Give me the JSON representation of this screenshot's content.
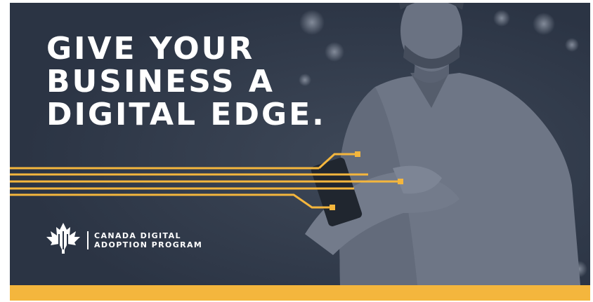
{
  "headline": {
    "lines": [
      "GIVE YOUR",
      "BUSINESS A",
      "DIGITAL EDGE."
    ]
  },
  "logo": {
    "icon": "maple-leaf-icon",
    "lines": [
      "CANADA DIGITAL",
      "ADOPTION PROGRAM"
    ]
  },
  "colors": {
    "background": "#2b3444",
    "accent": "#f4b63d",
    "text": "#ffffff"
  }
}
